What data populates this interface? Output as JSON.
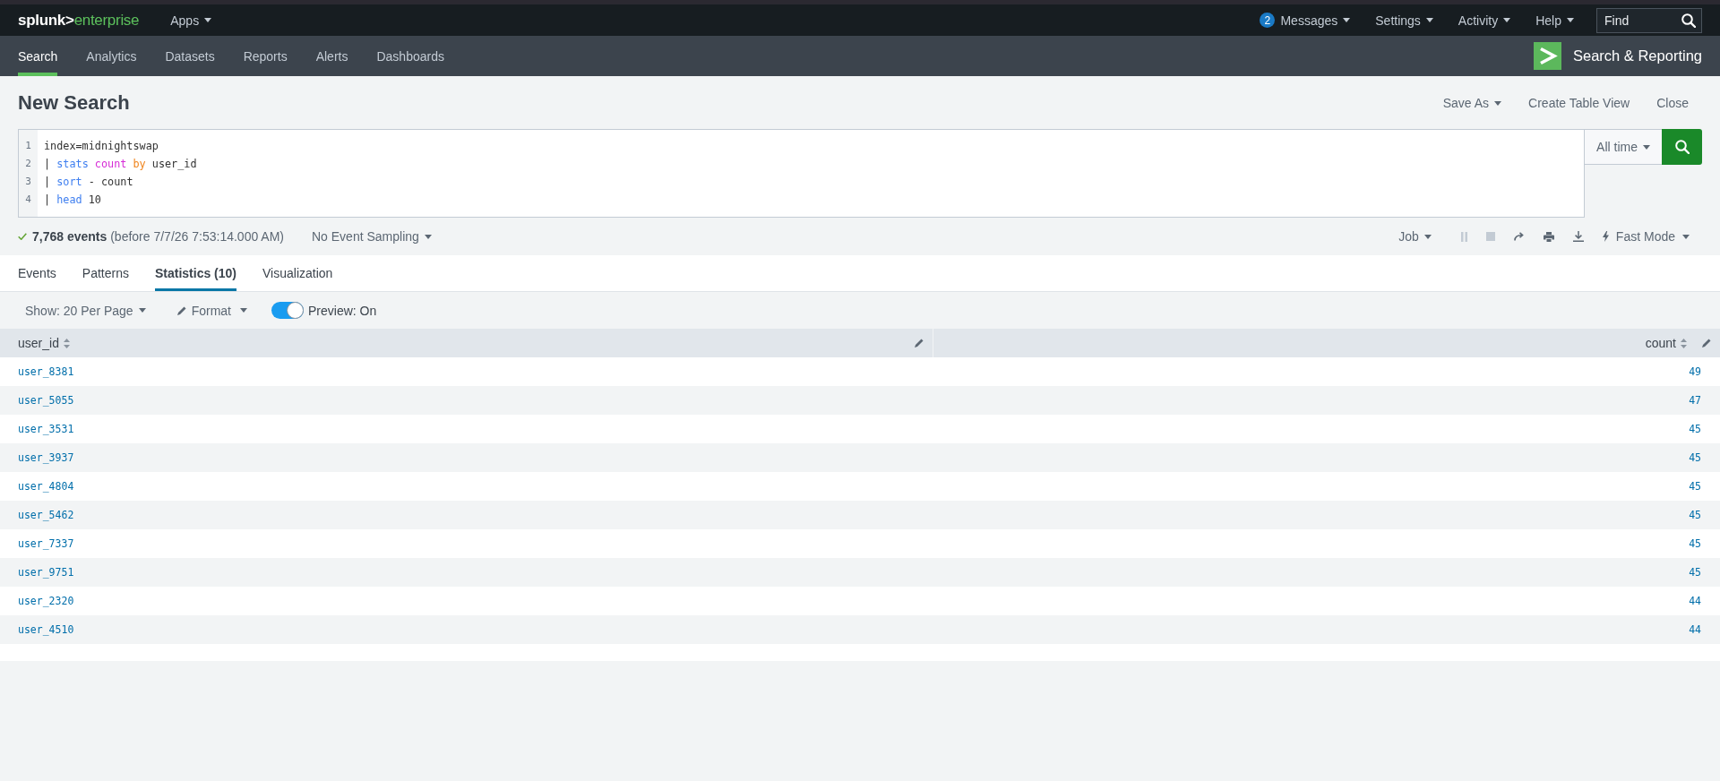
{
  "top_bar": {
    "logo": {
      "brand": "splunk>",
      "product": "enterprise"
    },
    "apps_menu": "Apps",
    "messages": {
      "count": "2",
      "label": "Messages"
    },
    "menus": [
      "Settings",
      "Activity",
      "Help"
    ],
    "find": {
      "placeholder": "Find"
    }
  },
  "app_bar": {
    "nav": [
      {
        "label": "Search",
        "selected": true
      },
      {
        "label": "Analytics",
        "selected": false
      },
      {
        "label": "Datasets",
        "selected": false
      },
      {
        "label": "Reports",
        "selected": false
      },
      {
        "label": "Alerts",
        "selected": false
      },
      {
        "label": "Dashboards",
        "selected": false
      }
    ],
    "app_name": "Search & Reporting"
  },
  "header": {
    "title": "New Search",
    "actions": [
      {
        "label": "Save As",
        "kind": "menu"
      },
      {
        "label": "Create Table View",
        "kind": "button"
      },
      {
        "label": "Close",
        "kind": "button"
      }
    ]
  },
  "search_bar": {
    "lines": [
      {
        "number": "1",
        "tokens": [
          {
            "text": "index=midnightswap",
            "kind": "plain"
          }
        ]
      },
      {
        "number": "2",
        "tokens": [
          {
            "text": "|",
            "kind": "plain"
          },
          {
            "text": "stats",
            "kind": "command"
          },
          {
            "text": "count",
            "kind": "function"
          },
          {
            "text": "by",
            "kind": "keyword"
          },
          {
            "text": "user_id",
            "kind": "plain"
          }
        ]
      },
      {
        "number": "3",
        "tokens": [
          {
            "text": "|",
            "kind": "plain"
          },
          {
            "text": "sort",
            "kind": "command"
          },
          {
            "text": "-",
            "kind": "plain"
          },
          {
            "text": "count",
            "kind": "plain"
          }
        ]
      },
      {
        "number": "4",
        "tokens": [
          {
            "text": "|",
            "kind": "plain"
          },
          {
            "text": "head",
            "kind": "command"
          },
          {
            "text": "10",
            "kind": "plain"
          }
        ]
      }
    ],
    "time_range": "All time"
  },
  "job_status": {
    "summary": "**7,768 events** (before 7/7/26 7:53:14.000 AM)",
    "sampling": "No Event Sampling",
    "job_menu": "Job",
    "actions": [
      {
        "disabled": true
      },
      {
        "disabled": true
      },
      {
        "disabled": false
      },
      {
        "disabled": false
      },
      {
        "disabled": false
      }
    ],
    "mode": "Fast Mode"
  },
  "results_tabs": [
    {
      "label": "Events",
      "selected": false
    },
    {
      "label": "Patterns",
      "selected": false
    },
    {
      "label": "Statistics (10)",
      "selected": true
    },
    {
      "label": "Visualization",
      "selected": false
    }
  ],
  "toolbar": {
    "per_page": "Show: 20 Per Page",
    "format": "Format",
    "preview": {
      "label": "Preview: On",
      "on": true
    }
  },
  "table": {
    "columns": [
      {
        "label": "user_id",
        "kind": "text"
      },
      {
        "label": "count",
        "kind": "number"
      }
    ],
    "rows": [
      [
        "user_8381",
        "49"
      ],
      [
        "user_5055",
        "47"
      ],
      [
        "user_3531",
        "45"
      ],
      [
        "user_3937",
        "45"
      ],
      [
        "user_4804",
        "45"
      ],
      [
        "user_5462",
        "45"
      ],
      [
        "user_7337",
        "45"
      ],
      [
        "user_9751",
        "45"
      ],
      [
        "user_2320",
        "44"
      ],
      [
        "user_4510",
        "44"
      ]
    ]
  }
}
